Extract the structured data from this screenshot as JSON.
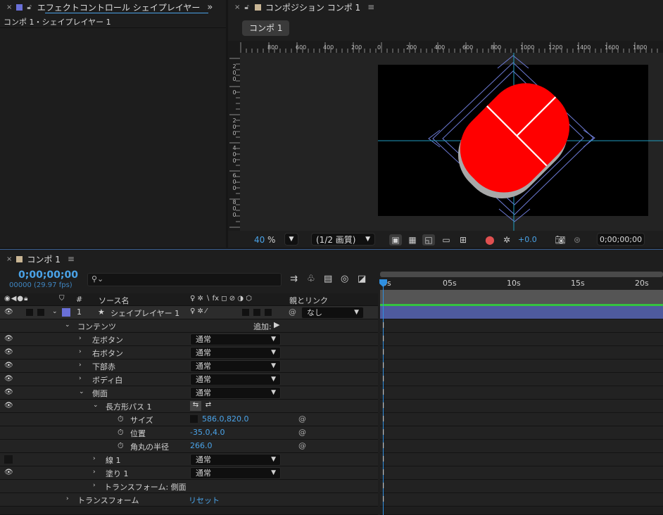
{
  "effects_panel": {
    "tab_title": "エフェクトコントロール シェイプレイヤー",
    "subtitle": "コンポ 1・シェイプレイヤー 1",
    "expand_glyph": "»"
  },
  "comp_panel": {
    "tab_title": "コンポジション コンポ 1",
    "comp_button": "コンポ 1",
    "ruler_h": [
      "800",
      "600",
      "400",
      "200",
      "0",
      "200",
      "400",
      "600",
      "800",
      "1000",
      "1200",
      "1400",
      "1600",
      "1800"
    ],
    "ruler_v": [
      [
        "2",
        "0",
        "0"
      ],
      [
        "0"
      ],
      [
        "2",
        "0",
        "0"
      ],
      [
        "4",
        "0",
        "0"
      ],
      [
        "6",
        "0",
        "0"
      ],
      [
        "8",
        "0",
        "0"
      ]
    ],
    "zoom_value": "40",
    "zoom_unit": "%",
    "resolution": "(1/2 画質)",
    "exposure": "+0.0",
    "timecode": "0;00;00;00",
    "colors": {
      "shape_fill": "#ff0000",
      "guide": "#1f9dbf",
      "bbox": "#6d7bd6"
    }
  },
  "timeline": {
    "tab_title": "コンポ 1",
    "timecode": "0;00;00;00",
    "frames": "00000 (29.97 fps)",
    "search_placeholder": "",
    "col_source": "ソース名",
    "col_parent": "親とリンク",
    "col_hash": "#",
    "switch_icons": "♀ ✲ ∖ fx ◻ ⊘ ◑ ⬡",
    "ruler_labels": [
      "0s",
      "05s",
      "10s",
      "15s",
      "20s"
    ],
    "layer": {
      "number": "1",
      "name": "シェイプレイヤー 1",
      "parent": "なし"
    },
    "contents_label": "コンテンツ",
    "add_label": "追加:",
    "groups": [
      {
        "name": "左ボタン",
        "mode": "通常"
      },
      {
        "name": "右ボタン",
        "mode": "通常"
      },
      {
        "name": "下部赤",
        "mode": "通常"
      },
      {
        "name": "ボディ白",
        "mode": "通常"
      },
      {
        "name": "側面",
        "mode": "通常"
      }
    ],
    "rect_path": "長方形パス 1",
    "props": [
      {
        "name": "サイズ",
        "value": "586.0,820.0"
      },
      {
        "name": "位置",
        "value": "-35.0,4.0"
      },
      {
        "name": "角丸の半径",
        "value": "266.0"
      }
    ],
    "stroke": {
      "name": "線 1",
      "mode": "通常"
    },
    "fill": {
      "name": "塗り 1",
      "mode": "通常"
    },
    "transform_side": "トランスフォーム: 側面",
    "transform": "トランスフォーム",
    "reset": "リセット"
  }
}
